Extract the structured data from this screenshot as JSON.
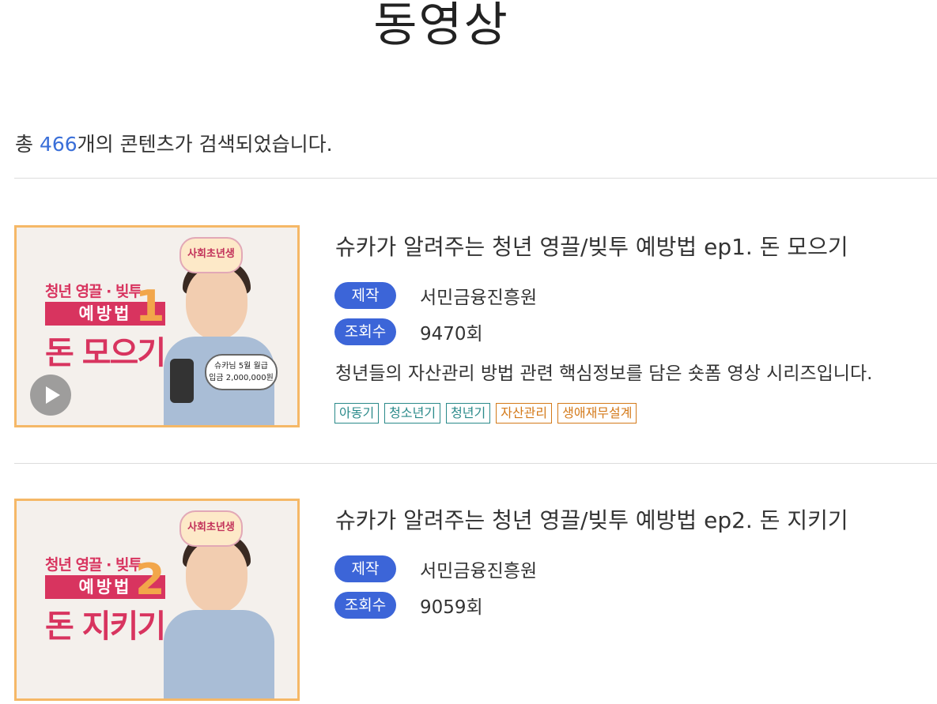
{
  "page": {
    "title": "동영상"
  },
  "summary": {
    "prefix": "총 ",
    "count": "466",
    "suffix": "개의 콘텐츠가 검색되었습니다."
  },
  "items": [
    {
      "title": "슈카가 알려주는 청년 영끌/빚투 예방법 ep1. 돈 모으기",
      "producer_label": "제작",
      "producer": "서민금융진흥원",
      "views_label": "조회수",
      "views": "9470회",
      "description": "청년들의 자산관리 방법 관련 핵심정보를 담은 숏폼 영상 시리즈입니다.",
      "tags": [
        "아동기",
        "청소년기",
        "청년기",
        "자산관리",
        "생애재무설계"
      ],
      "thumb": {
        "badge": "사회초년생",
        "line1": "청년 영끌 · 빚투",
        "line2": "예방법",
        "line3": "돈 모으기",
        "num": "1",
        "bubble1": "슈카님 5월 월급",
        "bubble2": "입금 2,000,000원"
      }
    },
    {
      "title": "슈카가 알려주는 청년 영끌/빚투 예방법 ep2. 돈 지키기",
      "producer_label": "제작",
      "producer": "서민금융진흥원",
      "views_label": "조회수",
      "views": "9059회",
      "thumb": {
        "badge": "사회초년생",
        "line1": "청년 영끌 · 빚투",
        "line2": "예방법",
        "line3": "돈 지키기",
        "num": "2"
      }
    }
  ],
  "colors": {
    "accent": "#3c65d8",
    "count": "#3a6fd8",
    "tag_teal": "#2a8a8a",
    "tag_orange": "#d47a1a",
    "thumb_border": "#f5b867"
  }
}
